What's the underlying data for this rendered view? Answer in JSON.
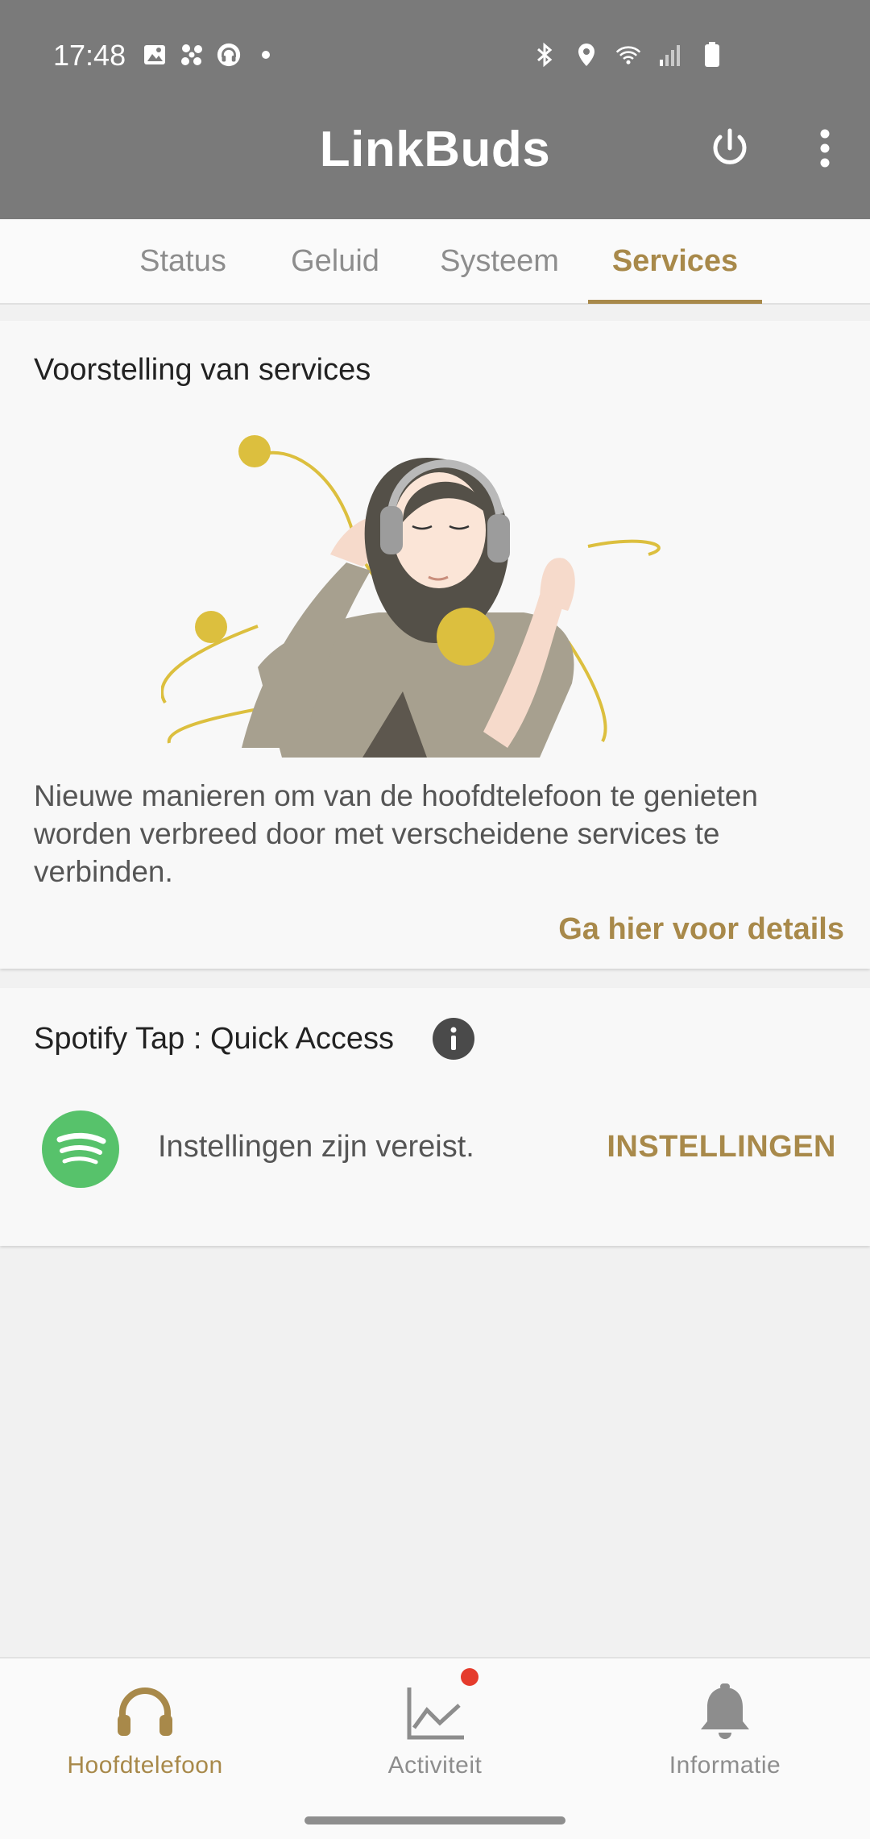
{
  "status_bar": {
    "time": "17:48",
    "left_icons": [
      "gallery-icon",
      "fan-icon",
      "headset-icon",
      "dot-icon"
    ],
    "right_icons": [
      "bluetooth-icon",
      "location-icon",
      "wifi-icon",
      "signal-icon",
      "battery-icon"
    ]
  },
  "header": {
    "title": "LinkBuds",
    "actions": [
      "power-icon",
      "more-vert-icon"
    ]
  },
  "tabs": [
    {
      "label": "Status",
      "active": false
    },
    {
      "label": "Geluid",
      "active": false
    },
    {
      "label": "Systeem",
      "active": false
    },
    {
      "label": "Services",
      "active": true
    }
  ],
  "services_card": {
    "title": "Voorstelling van services",
    "description": "Nieuwe manieren om van de hoofdtelefoon te genieten worden verbreed door met verscheidene services te verbinden.",
    "link": "Ga hier voor details"
  },
  "spotify_card": {
    "title": "Spotify Tap : Quick Access",
    "status": "Instellingen zijn vereist.",
    "button": "INSTELLINGEN"
  },
  "bottom_nav": [
    {
      "label": "Hoofdtelefoon",
      "icon": "headphones-icon",
      "active": true
    },
    {
      "label": "Activiteit",
      "icon": "activity-chart-icon",
      "active": false,
      "badge": true
    },
    {
      "label": "Informatie",
      "icon": "bell-icon",
      "active": false
    }
  ],
  "colors": {
    "accent": "#a8894a",
    "header": "#7a7a7a",
    "spotify": "#57c26b",
    "badge": "#e53b2c"
  }
}
